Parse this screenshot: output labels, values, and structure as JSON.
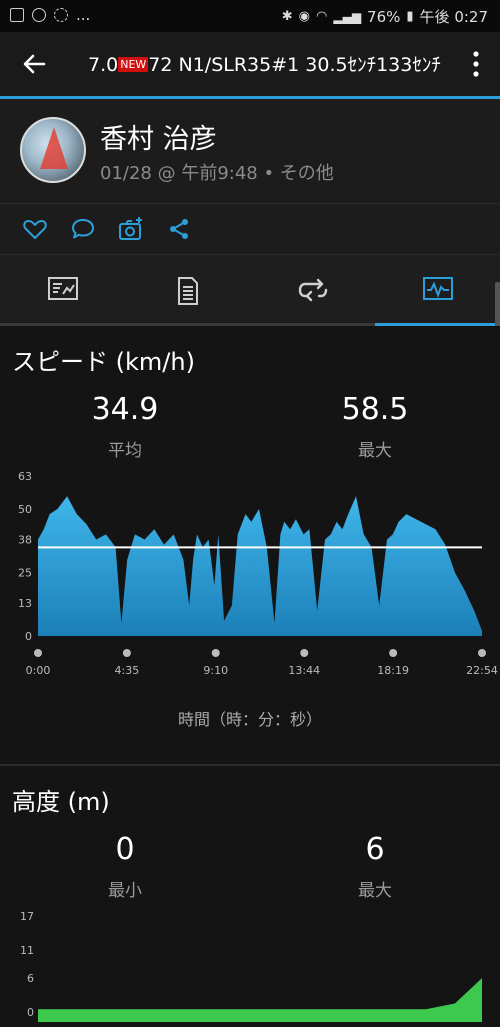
{
  "status_bar": {
    "battery": "76%",
    "time": "午後 0:27",
    "more": "..."
  },
  "app_bar": {
    "title_pre": "7.0",
    "title_badge": "NEW",
    "title_post": "72 N1/SLR35#1  30.5ｾﾝﾁ133ｾﾝﾁ"
  },
  "profile": {
    "name": "香村 治彦",
    "meta": "01/28 @ 午前9:48 • その他"
  },
  "icons": {
    "back": "back-arrow-icon",
    "menu": "more-vert-icon",
    "like": "heart-icon",
    "comment": "comment-icon",
    "photo": "add-photo-icon",
    "share": "share-icon",
    "tab1": "summary-icon",
    "tab2": "details-icon",
    "tab3": "laps-icon",
    "tab4": "chart-icon"
  },
  "colors": {
    "accent": "#2d9fd8",
    "speed_fill": "#29a3dc",
    "elevation_fill": "#3cc94e"
  },
  "speed": {
    "title": "スピード (km/h)",
    "avg_value": "34.9",
    "avg_label": "平均",
    "max_value": "58.5",
    "max_label": "最大",
    "x_title": "時間（時：分：秒）"
  },
  "elevation": {
    "title": "高度 (m)",
    "min_value": "0",
    "min_label": "最小",
    "max_value": "6",
    "max_label": "最大"
  },
  "chart_data": [
    {
      "type": "area",
      "title": "スピード (km/h)",
      "xlabel": "時間（時：分：秒）",
      "ylabel": "km/h",
      "ylim": [
        0,
        63
      ],
      "y_ticks": [
        "0",
        "13",
        "25",
        "38",
        "50",
        "63"
      ],
      "x_ticks": [
        "0:00",
        "4:35",
        "9:10",
        "13:44",
        "18:19",
        "22:54"
      ],
      "average_line": 34.9,
      "x_minutes": [
        0,
        0.3,
        0.6,
        1.0,
        1.5,
        2.0,
        2.5,
        3.0,
        3.5,
        4.0,
        4.3,
        4.6,
        5.0,
        5.5,
        6.0,
        6.5,
        7.0,
        7.5,
        7.8,
        8.0,
        8.2,
        8.5,
        8.8,
        9.1,
        9.3,
        9.6,
        10.0,
        10.3,
        10.7,
        11.0,
        11.4,
        11.8,
        12.2,
        12.5,
        12.7,
        13.0,
        13.3,
        13.7,
        14.0,
        14.4,
        14.8,
        15.1,
        15.4,
        15.7,
        16.0,
        16.4,
        16.8,
        17.2,
        17.6,
        18.0,
        18.3,
        18.6,
        19.0,
        19.5,
        20.0,
        20.5,
        21.0,
        21.5,
        22.0,
        22.5,
        22.9
      ],
      "values": [
        38,
        42,
        48,
        50,
        55,
        48,
        44,
        38,
        40,
        35,
        5,
        30,
        40,
        38,
        42,
        36,
        40,
        30,
        12,
        30,
        40,
        35,
        38,
        20,
        40,
        6,
        12,
        40,
        48,
        45,
        50,
        35,
        5,
        40,
        45,
        42,
        46,
        40,
        42,
        10,
        38,
        40,
        45,
        42,
        48,
        55,
        40,
        35,
        12,
        38,
        40,
        45,
        48,
        46,
        44,
        42,
        36,
        25,
        18,
        10,
        2
      ]
    },
    {
      "type": "area",
      "title": "高度 (m)",
      "ylabel": "m",
      "ylim": [
        0,
        17
      ],
      "y_ticks": [
        "0",
        "6",
        "11",
        "17"
      ],
      "x_minutes": [
        0,
        2,
        5,
        10,
        15,
        20,
        21.5,
        22.9
      ],
      "values": [
        0.5,
        0.5,
        0.5,
        0.5,
        0.5,
        0.5,
        1.5,
        6
      ]
    }
  ]
}
